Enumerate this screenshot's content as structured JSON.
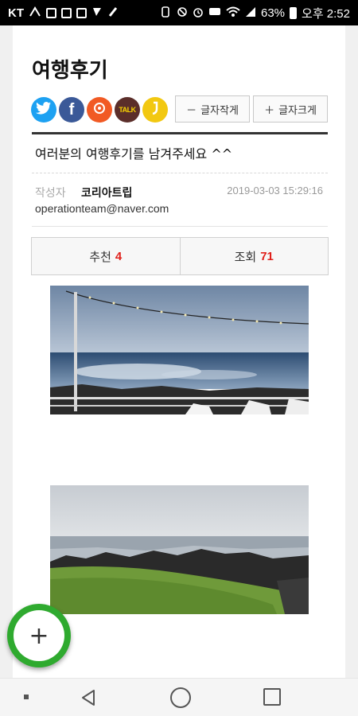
{
  "status_bar": {
    "carrier": "KT",
    "battery_percent": "63%",
    "time": "오후 2:52",
    "icons": [
      "carrier-signal-icon",
      "facebook-notification-icon",
      "facebook-notification-icon",
      "mail-icon",
      "app-notification-icon",
      "mute-icon",
      "vibrate-icon",
      "alarm-icon",
      "message-icon",
      "wifi-icon",
      "signal-icon",
      "battery-icon"
    ]
  },
  "page": {
    "title": "여행후기",
    "share": {
      "twitter": "twitter-icon",
      "facebook": "facebook-icon",
      "kakaostory": "kakaostory-icon",
      "kakaotalk_label": "TALK",
      "band": "band-icon"
    },
    "font_controls": {
      "smaller_label": "글자작게",
      "smaller_symbol": "－",
      "larger_label": "글자크게",
      "larger_symbol": "＋"
    },
    "post": {
      "title": "여러분의 여행후기를 남겨주세요 ^^",
      "author_label": "작성자",
      "author_name": "코리아트립",
      "date": "2019-03-03 15:29:16",
      "email": "operationteam@naver.com"
    },
    "stats": {
      "recommend_label": "추천",
      "recommend_count": "4",
      "views_label": "조회",
      "views_count": "71"
    },
    "photos": [
      "seaside-terrace-photo",
      "rocky-coast-grass-photo"
    ]
  },
  "fab": {
    "symbol": "+",
    "name": "add-icon"
  },
  "nav": {
    "back": "back-icon",
    "home": "home-icon",
    "recent": "recent-apps-icon"
  },
  "colors": {
    "accent_red": "#e0201b",
    "fab_green": "#2faa2f",
    "twitter": "#1da1f2",
    "facebook": "#3b5998"
  }
}
